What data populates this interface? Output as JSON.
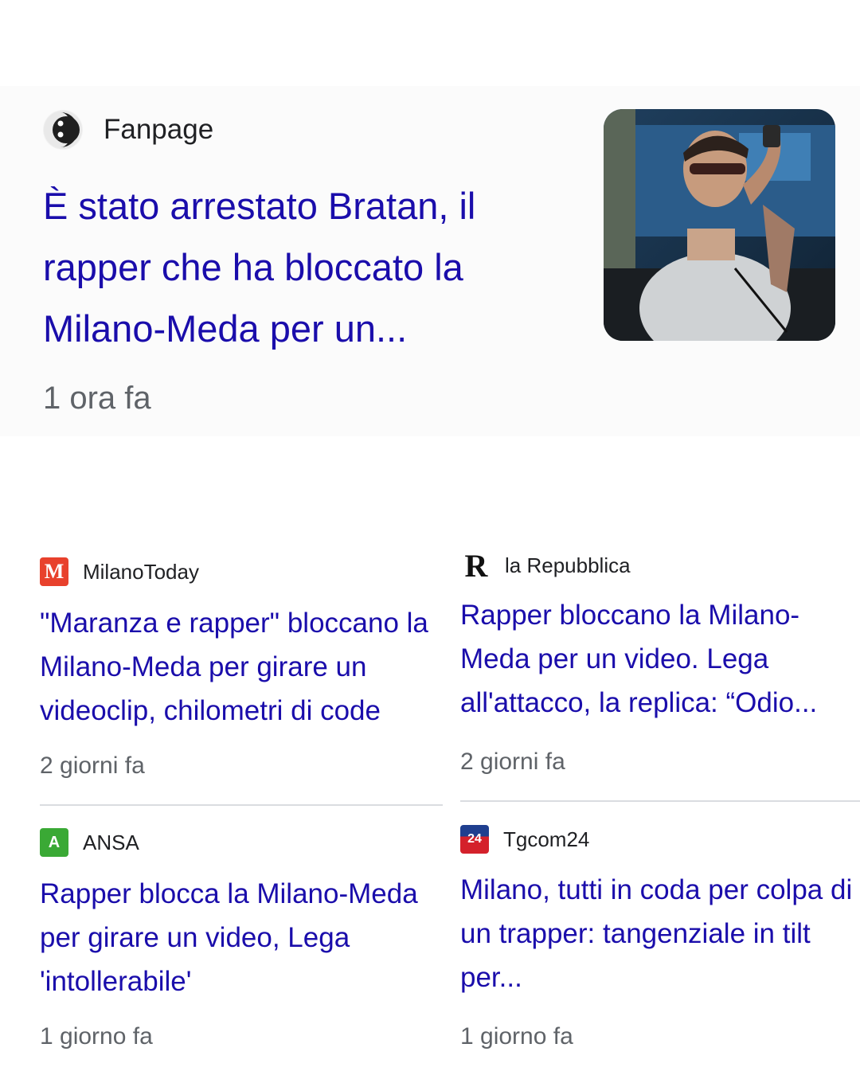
{
  "colors": {
    "headline": "#1a0dab",
    "source": "#202124",
    "time": "#5f6368",
    "divider": "#dadce0"
  },
  "top_story": {
    "source": "Fanpage",
    "source_icon": "fanpage-logo-icon",
    "headline": "È stato arrestato Bratan, il rapper che ha bloccato la Milano-Meda per un...",
    "time": "1 ora fa",
    "thumbnail": "rapper-photo"
  },
  "stories": [
    {
      "source": "MilanoToday",
      "source_icon": "milanotoday-logo-icon",
      "icon_letter": "M",
      "icon_color": "#e8412c",
      "headline": "\"Maranza e rapper\" bloccano la Milano-Meda per girare un videoclip, chilometri di code",
      "time": "2 giorni fa"
    },
    {
      "source": "la Repubblica",
      "source_icon": "repubblica-logo-icon",
      "icon_letter": "R",
      "headline": "Rapper bloccano la Milano-Meda per un video. Lega all'attacco, la replica: “Odio...",
      "time": "2 giorni fa"
    },
    {
      "source": "ANSA",
      "source_icon": "ansa-logo-icon",
      "icon_letter": "A",
      "icon_color": "#3aa935",
      "headline": "Rapper blocca la Milano-Meda per girare un video, Lega 'intollerabile'",
      "time": "1 giorno fa"
    },
    {
      "source": "Tgcom24",
      "source_icon": "tgcom24-logo-icon",
      "icon_letter": "24",
      "icon_color": "#d4212b",
      "headline": "Milano, tutti in coda per colpa di un trapper: tangenziale in tilt per...",
      "time": "1 giorno fa"
    }
  ]
}
